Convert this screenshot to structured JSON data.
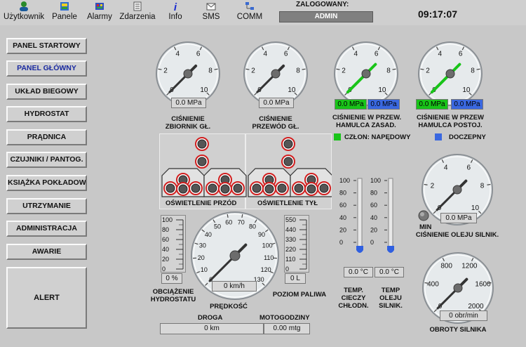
{
  "toolbar": {
    "items": [
      {
        "label": "Użytkownik",
        "icon": "user-icon"
      },
      {
        "label": "Panele",
        "icon": "panels-icon"
      },
      {
        "label": "Alarmy",
        "icon": "alarm-icon"
      },
      {
        "label": "Zdarzenia",
        "icon": "events-icon"
      },
      {
        "label": "Info",
        "icon": "info-icon"
      },
      {
        "label": "SMS",
        "icon": "sms-icon"
      },
      {
        "label": "COMM",
        "icon": "comm-icon"
      }
    ],
    "login_label": "ZALOGOWANY:",
    "login_user": "ADMIN",
    "clock": "09:17:07"
  },
  "nav": {
    "items": [
      {
        "label": "PANEL STARTOWY"
      },
      {
        "label": "PANEL GŁÓWNY"
      },
      {
        "label": "UKŁAD BIEGOWY"
      },
      {
        "label": "HYDROSTAT"
      },
      {
        "label": "PRĄDNICA"
      },
      {
        "label": "CZUJNIKI / PANTOG."
      },
      {
        "label": "KSIĄŻKA POKŁADOWA"
      },
      {
        "label": "UTRZYMANIE"
      },
      {
        "label": "ADMINISTRACJA"
      },
      {
        "label": "AWARIE"
      }
    ],
    "alert": "ALERT"
  },
  "gauges": {
    "tank": {
      "ticks": [
        "0",
        "2",
        "4",
        "6",
        "8",
        "10"
      ],
      "value": 0,
      "reading": "0.0 MPa",
      "label1": "CIŚNIENIE",
      "label2": "ZBIORNIK GŁ."
    },
    "pipe": {
      "ticks": [
        "0",
        "2",
        "4",
        "6",
        "8",
        "10"
      ],
      "value": 0,
      "reading": "0.0 MPa",
      "label1": "CIŚNIENIE",
      "label2": "PRZEWÓD GŁ."
    },
    "brake_main": {
      "ticks": [
        "0",
        "2",
        "4",
        "6",
        "8",
        "10"
      ],
      "value": 0,
      "reading_green": "0.0 MPa",
      "reading_blue": "0.0 MPa",
      "label1": "CIŚNIENIE W PRZEW.",
      "label2": "HAMULCA ZASAD."
    },
    "brake_park": {
      "ticks": [
        "0",
        "2",
        "4",
        "6",
        "8",
        "10"
      ],
      "value": 0,
      "reading_green": "0.0 MPa",
      "reading_blue": "0.0 MPa",
      "label1": "CIŚNIENIE W PRZEW",
      "label2": "HAMULCA  POSTOJ."
    },
    "oil_pressure": {
      "ticks": [
        "0",
        "2",
        "4",
        "6",
        "8",
        "10"
      ],
      "value": 0,
      "reading": "0.0 MPa",
      "min_label": "MIN",
      "label": "CIŚNIENIE OLEJU SILNIK."
    },
    "speed": {
      "ticks": [
        "0",
        "10",
        "20",
        "30",
        "40",
        "50",
        "60",
        "70",
        "80",
        "90",
        "100",
        "110",
        "120",
        "130"
      ],
      "value": 0,
      "reading": "0 km/h",
      "label": "PRĘDKOŚĆ"
    },
    "rpm": {
      "ticks": [
        "0",
        "400",
        "800",
        "1200",
        "1600",
        "2000"
      ],
      "value": 0,
      "reading": "0 obr/min",
      "label": "OBROTY SILNIKA"
    }
  },
  "legend": {
    "powered": "CZŁON: NAPĘDOWY",
    "trailer": "DOCZEPNY",
    "powered_color": "#19c419",
    "trailer_color": "#3a68e0"
  },
  "lights": {
    "front": "OŚWIETLENIE PRZÓD",
    "rear": "OŚWIETLENIE TYŁ"
  },
  "hydro_load": {
    "ticks": [
      "100",
      "80",
      "60",
      "40",
      "20",
      "0"
    ],
    "value": 0,
    "reading": "0 %",
    "label1": "OBCIĄŻENIE",
    "label2": "HYDROSTATU"
  },
  "fuel": {
    "ticks": [
      "550",
      "440",
      "330",
      "220",
      "110",
      "0"
    ],
    "value": 0,
    "reading": "0 L",
    "label": "POZIOM PALIWA"
  },
  "coolant_temp": {
    "ticks": [
      "100",
      "80",
      "60",
      "40",
      "20",
      "0"
    ],
    "value": 0,
    "reading": "0.0 °C",
    "label1": "TEMP.",
    "label2": "CIECZY",
    "label3": "CHŁODN."
  },
  "oil_temp": {
    "ticks": [
      "100",
      "80",
      "60",
      "40",
      "20",
      "0"
    ],
    "value": 0,
    "reading": "0.0 °C",
    "label1": "TEMP",
    "label2": "OLEJU",
    "label3": "SILNIK."
  },
  "odometer": {
    "road_label": "DROGA",
    "road_value": "0 km",
    "hours_label": "MOTOGODZINY",
    "hours_value": "0.00 mtg"
  }
}
